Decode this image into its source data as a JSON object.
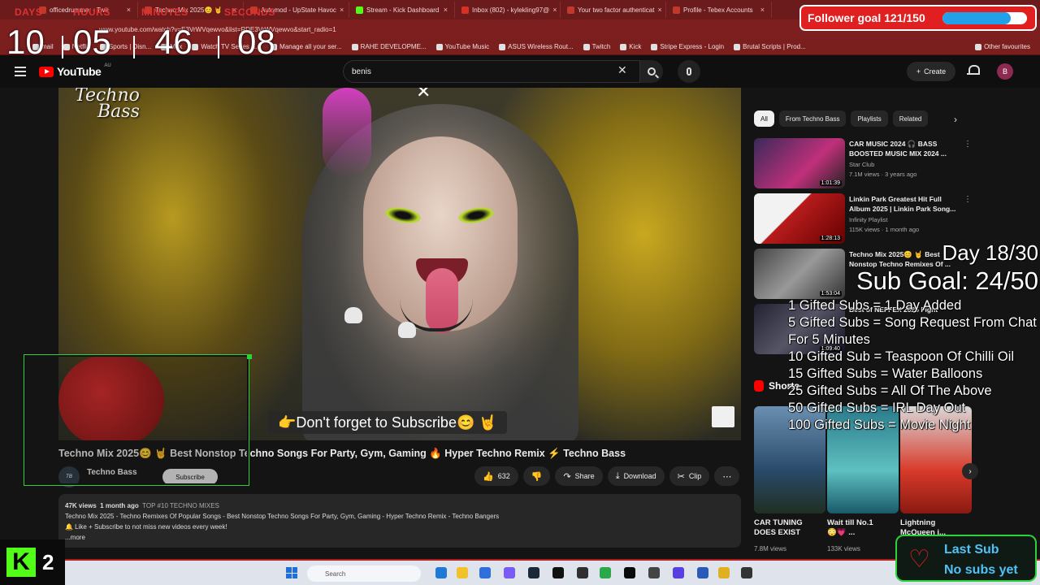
{
  "browser": {
    "tabs": [
      {
        "label": "officedrummer - Twit"
      },
      {
        "label": "Techno Mix 2025😊 🤘"
      },
      {
        "label": "Automod - UpState Havoc"
      },
      {
        "label": "Stream - Kick Dashboard"
      },
      {
        "label": "Inbox (802) - kylekling97@"
      },
      {
        "label": "Your two factor authenticat"
      },
      {
        "label": "Profile - Tebex Accounts"
      }
    ],
    "url": "www.youtube.com/watch?v=E3VrWVqewvo&list=RDE3VrWVqewvo&start_radio=1",
    "bookmarks": [
      "mail",
      "Netflix",
      "Sports | Disn...",
      "Max",
      "Watch TV Series &...",
      "Manage all your ser...",
      "RAHE DEVELOPME...",
      "YouTube Music",
      "ASUS Wireless Rout...",
      "Twitch",
      "Kick",
      "Stripe Express - Login",
      "Brutal Scripts | Prod..."
    ],
    "bookmarks_right": "Other favourites"
  },
  "youtube": {
    "logo": "YouTube",
    "region": "AU",
    "search_value": "benis",
    "create_label": "Create",
    "avatar_letter": "B"
  },
  "video": {
    "channel_logo_line1": "Techno",
    "channel_logo_line2": "Bass",
    "overlay_banner": "👉Don't forget to Subscribe😊 🤘",
    "title": "Techno Mix 2025😊 🤘 Best Nonstop Techno Songs For Party, Gym, Gaming 🔥 Hyper Techno Remix ⚡ Techno Bass",
    "channel_name": "Techno Bass",
    "subscribe_label": "Subscribe",
    "likes": "632",
    "share_label": "Share",
    "download_label": "Download",
    "clip_label": "Clip",
    "views": "47K views",
    "age": "1 month ago",
    "tag": "TOP #10 TECHNO MIXES",
    "desc_line1": "Techno Mix 2025 - Techno Remixes Of Popular Songs - Best Nonstop Techno Songs For Party, Gym, Gaming - Hyper Techno Remix - Techno Bangers",
    "desc_line2": "🔔 Like + Subscribe to not miss new videos every week!",
    "more": "...more"
  },
  "sidebar": {
    "chips": [
      "All",
      "From Techno Bass",
      "Playlists",
      "Related"
    ],
    "recommendations": [
      {
        "title": "CAR MUSIC 2024 🎧 BASS BOOSTED MUSIC MIX 2024 ...",
        "channel": "Star Club",
        "meta": "7.1M views · 3 years ago",
        "duration": "1:01:39"
      },
      {
        "title": "Linkin Park Greatest Hit Full Album 2025 | Linkin Park Song...",
        "channel": "Infinity Playlist",
        "meta": "115K views · 1 month ago",
        "duration": "1:28:13"
      },
      {
        "title": "Techno Mix 2025😊 🤘 Best Nonstop Techno Remixes Of ...",
        "channel": "",
        "meta": "",
        "duration": "1:53:04"
      },
      {
        "title": "Best of NEFFEX 2025 Fight",
        "channel": "",
        "meta": "",
        "duration": "1:09:40"
      }
    ],
    "shorts_label": "Shorts",
    "shorts": [
      {
        "title": "CAR TUNING DOES EXIST",
        "views": "7.8M views"
      },
      {
        "title": "Wait till No.1 😳💗 ...",
        "views": "133K views"
      },
      {
        "title": "Lightning McQueen i...",
        "views": ""
      }
    ]
  },
  "overlay": {
    "timer": {
      "labels": [
        "DAYS",
        "HOURS",
        "MINUTES",
        "SECONDS"
      ],
      "values": [
        "10",
        "05",
        "46",
        "08"
      ]
    },
    "follower_goal": {
      "label": "Follower goal 121/150",
      "current": 121,
      "target": 150
    },
    "day": "Day 18/30",
    "sub_goal": "Sub Goal: 24/50",
    "gift_rules": [
      "1 Gifted Subs = 1 Day Added",
      "5 Gifted Subs = Song Request From Chat For 5 Minutes",
      "10 Gifted Sub = Teaspoon Of Chilli Oil",
      "15 Gifted Subs = Water Balloons",
      "25 Gifted Subs = All Of The Above",
      "50 Gifted Subs = IRL Day Out",
      "100 Gifted Subs = Movie Night"
    ],
    "kick_viewers": "2",
    "last_sub_label": "Last Sub",
    "last_sub_value": "No subs yet"
  },
  "taskbar": {
    "search_placeholder": "Search"
  }
}
